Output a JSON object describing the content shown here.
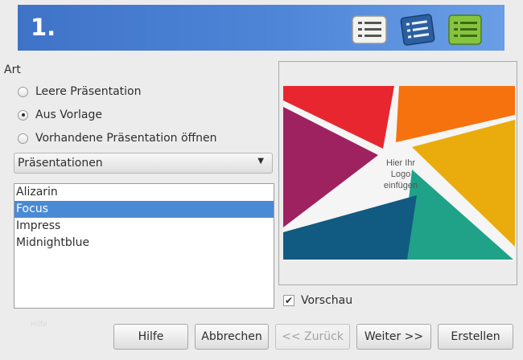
{
  "header": {
    "step": "1.",
    "steps": [
      {
        "icon": "list-icon",
        "active": false
      },
      {
        "icon": "list-icon",
        "active": false
      },
      {
        "icon": "list-icon",
        "active": true
      }
    ]
  },
  "type_section": {
    "label": "Art",
    "options": [
      {
        "label": "Leere Präsentation",
        "checked": false
      },
      {
        "label": "Aus Vorlage",
        "checked": true
      },
      {
        "label": "Vorhandene Präsentation öffnen",
        "checked": false
      }
    ]
  },
  "category_dropdown": {
    "value": "Präsentationen"
  },
  "templates": {
    "items": [
      "Alizarin",
      "Focus",
      "Impress",
      "Midnightblue"
    ],
    "selected": "Focus"
  },
  "ghost_text": "Hilfe",
  "preview": {
    "logo_text": [
      "Hier Ihr",
      "Logo",
      "einfügen"
    ],
    "colors": {
      "red": "#e8262f",
      "orange": "#f5720f",
      "yellow": "#eaab0c",
      "teal": "#1fa288",
      "navy": "#115a82",
      "magenta": "#9e2160"
    },
    "checkbox_label": "Vorschau",
    "checkbox_checked": true
  },
  "buttons": {
    "help": "Hilfe",
    "cancel": "Abbrechen",
    "back": "<< Zurück",
    "next": "Weiter >>",
    "create": "Erstellen"
  }
}
